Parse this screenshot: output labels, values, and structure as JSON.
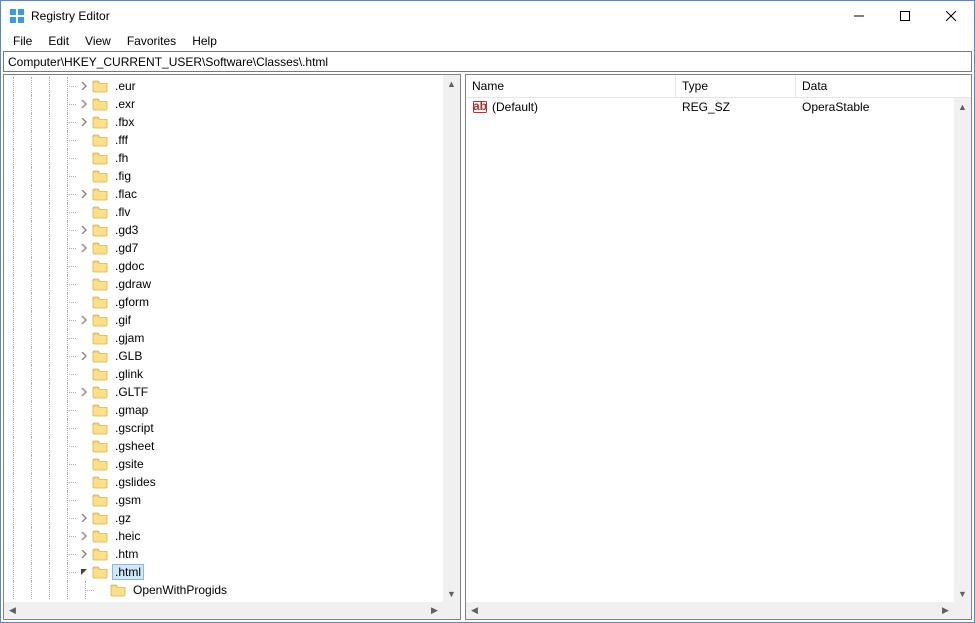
{
  "title": "Registry Editor",
  "menu": [
    "File",
    "Edit",
    "View",
    "Favorites",
    "Help"
  ],
  "address": "Computer\\HKEY_CURRENT_USER\\Software\\Classes\\.html",
  "tree": {
    "nodes": [
      {
        "label": ".eur",
        "expandable": true
      },
      {
        "label": ".exr",
        "expandable": true
      },
      {
        "label": ".fbx",
        "expandable": true
      },
      {
        "label": ".fff",
        "expandable": false
      },
      {
        "label": ".fh",
        "expandable": false
      },
      {
        "label": ".fig",
        "expandable": false
      },
      {
        "label": ".flac",
        "expandable": true
      },
      {
        "label": ".flv",
        "expandable": false
      },
      {
        "label": ".gd3",
        "expandable": true
      },
      {
        "label": ".gd7",
        "expandable": true
      },
      {
        "label": ".gdoc",
        "expandable": false
      },
      {
        "label": ".gdraw",
        "expandable": false
      },
      {
        "label": ".gform",
        "expandable": false
      },
      {
        "label": ".gif",
        "expandable": true
      },
      {
        "label": ".gjam",
        "expandable": false
      },
      {
        "label": ".GLB",
        "expandable": true
      },
      {
        "label": ".glink",
        "expandable": false
      },
      {
        "label": ".GLTF",
        "expandable": true
      },
      {
        "label": ".gmap",
        "expandable": false
      },
      {
        "label": ".gscript",
        "expandable": false
      },
      {
        "label": ".gsheet",
        "expandable": false
      },
      {
        "label": ".gsite",
        "expandable": false
      },
      {
        "label": ".gslides",
        "expandable": false
      },
      {
        "label": ".gsm",
        "expandable": false
      },
      {
        "label": ".gz",
        "expandable": true
      },
      {
        "label": ".heic",
        "expandable": true
      },
      {
        "label": ".htm",
        "expandable": true
      },
      {
        "label": ".html",
        "expandable": true,
        "open": true,
        "selected": true
      }
    ],
    "child": {
      "label": "OpenWithProgids"
    }
  },
  "list": {
    "columns": {
      "name": "Name",
      "type": "Type",
      "data": "Data"
    },
    "rows": [
      {
        "name": "(Default)",
        "type": "REG_SZ",
        "data": "OperaStable"
      }
    ]
  }
}
